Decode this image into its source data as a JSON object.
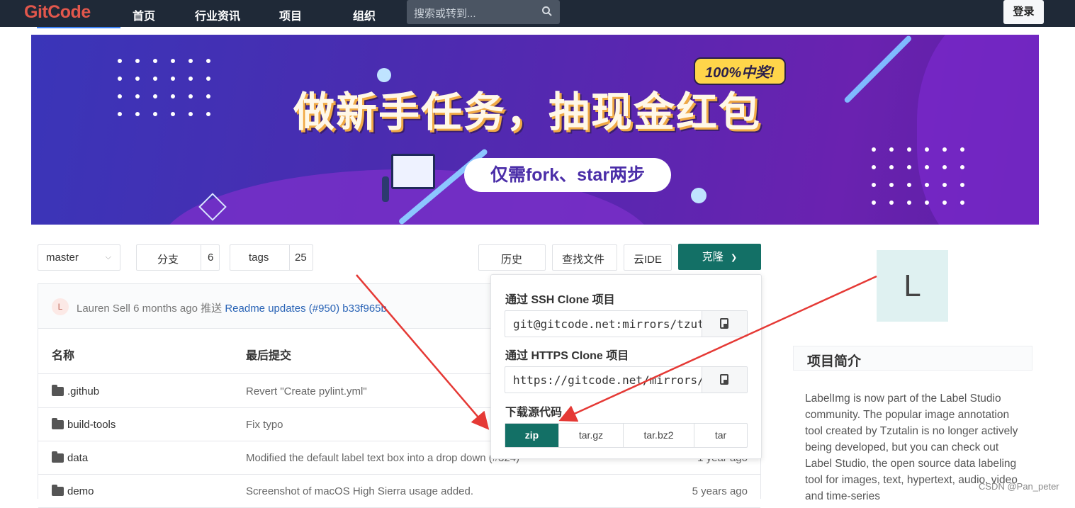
{
  "nav": {
    "logo": "GitCode",
    "links": [
      "首页",
      "行业资讯",
      "项目",
      "组织"
    ],
    "search_placeholder": "搜索或转到...",
    "login": "登录"
  },
  "banner": {
    "headline": "做新手任务，抽现金红包",
    "prize": "100%中奖!",
    "pill": "仅需fork、star两步"
  },
  "toolbar": {
    "branch": "master",
    "branches_label": "分支",
    "branches_count": "6",
    "tags_label": "tags",
    "tags_count": "25",
    "history": "历史",
    "find_file": "查找文件",
    "cloud_ide": "云IDE",
    "clone": "克隆"
  },
  "commit": {
    "avatar": "L",
    "author": "Lauren Sell",
    "when": "6 months ago",
    "action": "推送",
    "message": "Readme updates (#950)",
    "hash": "b33f965b"
  },
  "table": {
    "col_name": "名称",
    "col_last_commit": "最后提交",
    "rows": [
      {
        "name": ".github",
        "msg": "Revert \"Create pylint.yml\"",
        "age": ""
      },
      {
        "name": "build-tools",
        "msg": "Fix typo",
        "age": ""
      },
      {
        "name": "data",
        "msg": "Modified the default label text box into a drop down (#324)",
        "age": "1 year ago"
      },
      {
        "name": "demo",
        "msg": "Screenshot of macOS High Sierra usage added.",
        "age": "5 years ago"
      }
    ]
  },
  "clone_dropdown": {
    "ssh_title": "通过 SSH Clone 项目",
    "ssh_url": "git@gitcode.net:mirrors/tzutalin/labelImg.git",
    "https_title": "通过 HTTPS Clone 项目",
    "https_url": "https://gitcode.net/mirrors/tzutalin/labelImg.git",
    "download_title": "下载源代码",
    "formats": [
      "zip",
      "tar.gz",
      "tar.bz2",
      "tar"
    ],
    "selected_format": "zip"
  },
  "sidebar": {
    "avatar_letter": "L",
    "intro_title": "项目简介",
    "intro_text": "LabelImg is now part of the Label Studio community. The popular image annotation tool created by Tzutalin is no longer actively being developed, but you can check out Label Studio, the open source data labeling tool for images, text, hypertext, audio, video and time-series"
  },
  "watermark": "CSDN @Pan_peter",
  "colors": {
    "nav_bg": "#1f2937",
    "accent_green": "#137066",
    "link_blue": "#2a64b6",
    "annotation_red": "#e53935"
  }
}
